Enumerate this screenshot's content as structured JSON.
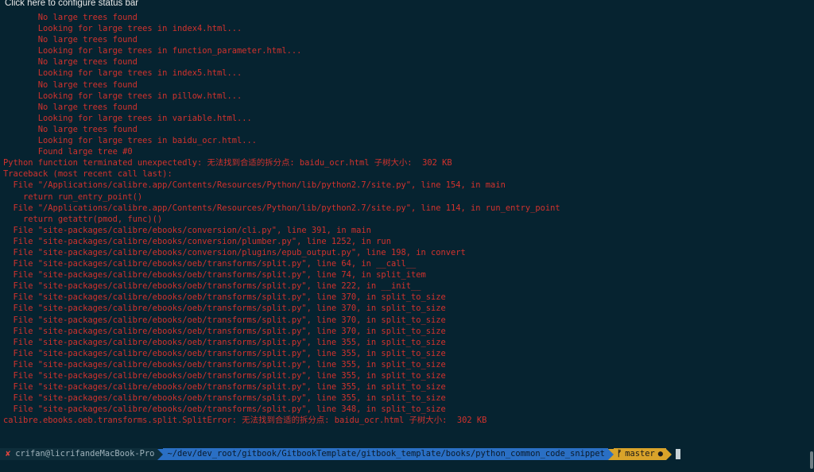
{
  "status_hint": "Click here to configure status bar",
  "terminal": {
    "output_lines": [
      "       No large trees found",
      "       Looking for large trees in index4.html...",
      "       No large trees found",
      "       Looking for large trees in function_parameter.html...",
      "       No large trees found",
      "       Looking for large trees in index5.html...",
      "       No large trees found",
      "       Looking for large trees in pillow.html...",
      "       No large trees found",
      "       Looking for large trees in variable.html...",
      "       No large trees found",
      "       Looking for large trees in baidu_ocr.html...",
      "       Found large tree #0",
      "Python function terminated unexpectedly: 无法找到合适的拆分点: baidu_ocr.html 子树大小:  302 KB",
      "Traceback (most recent call last):",
      "  File \"/Applications/calibre.app/Contents/Resources/Python/lib/python2.7/site.py\", line 154, in main",
      "    return run_entry_point()",
      "  File \"/Applications/calibre.app/Contents/Resources/Python/lib/python2.7/site.py\", line 114, in run_entry_point",
      "    return getattr(pmod, func)()",
      "  File \"site-packages/calibre/ebooks/conversion/cli.py\", line 391, in main",
      "  File \"site-packages/calibre/ebooks/conversion/plumber.py\", line 1252, in run",
      "  File \"site-packages/calibre/ebooks/conversion/plugins/epub_output.py\", line 198, in convert",
      "  File \"site-packages/calibre/ebooks/oeb/transforms/split.py\", line 64, in __call__",
      "  File \"site-packages/calibre/ebooks/oeb/transforms/split.py\", line 74, in split_item",
      "  File \"site-packages/calibre/ebooks/oeb/transforms/split.py\", line 222, in __init__",
      "  File \"site-packages/calibre/ebooks/oeb/transforms/split.py\", line 370, in split_to_size",
      "  File \"site-packages/calibre/ebooks/oeb/transforms/split.py\", line 370, in split_to_size",
      "  File \"site-packages/calibre/ebooks/oeb/transforms/split.py\", line 370, in split_to_size",
      "  File \"site-packages/calibre/ebooks/oeb/transforms/split.py\", line 370, in split_to_size",
      "  File \"site-packages/calibre/ebooks/oeb/transforms/split.py\", line 355, in split_to_size",
      "  File \"site-packages/calibre/ebooks/oeb/transforms/split.py\", line 355, in split_to_size",
      "  File \"site-packages/calibre/ebooks/oeb/transforms/split.py\", line 355, in split_to_size",
      "  File \"site-packages/calibre/ebooks/oeb/transforms/split.py\", line 355, in split_to_size",
      "  File \"site-packages/calibre/ebooks/oeb/transforms/split.py\", line 355, in split_to_size",
      "  File \"site-packages/calibre/ebooks/oeb/transforms/split.py\", line 355, in split_to_size",
      "  File \"site-packages/calibre/ebooks/oeb/transforms/split.py\", line 348, in split_to_size",
      "calibre.ebooks.oeb.transforms.split.SplitError: 无法找到合适的拆分点: baidu_ocr.html 子树大小:  302 KB"
    ]
  },
  "prompt": {
    "status_icon": "x-icon",
    "status_glyph": "✘",
    "user_host": "crifan@licrifandeMacBook-Pro",
    "path": "~/dev/dev_root/gitbook/GitbookTemplate/gitbook_template/books/python_common_code_snippet",
    "branch_icon": "git-branch-icon",
    "branch_glyph": "ᚠ",
    "branch": "master",
    "dirty_icon": "dirty-dot-icon",
    "dirty_glyph": "●"
  },
  "colors": {
    "background": "#062330",
    "error_text": "#d2322d",
    "path_segment": "#2a6fc4",
    "git_segment": "#d9a32a"
  }
}
